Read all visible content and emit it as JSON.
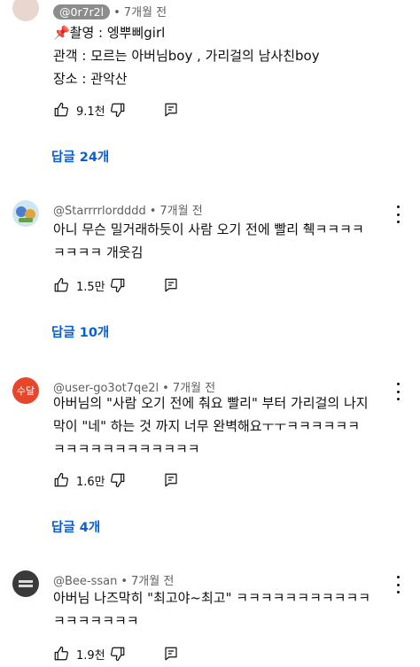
{
  "comments": [
    {
      "handle": "@0r7r2l",
      "time": "7개월 전",
      "lines": [
        "📌촬영 : 엥뿌삐girl",
        "관객 : 모르는 아버님boy , 가리걸의 남사친boy",
        "장소 : 관악산"
      ],
      "likes": "9.1천",
      "replies": "답글 24개"
    },
    {
      "handle": "@Starrrrlordddd",
      "time": "7개월 전",
      "lines": [
        "아니 무슨 밀거래하듯이 사람 오기 전에 빨리 췍ㅋㅋㅋㅋ",
        "ㅋㅋㅋㅋ 개웃김"
      ],
      "likes": "1.5만",
      "replies": "답글 10개"
    },
    {
      "handle": "@user-go3ot7qe2l",
      "time": "7개월 전",
      "avatar_text": "수달",
      "lines": [
        "아버님의 \"사람 오기 전에 춰요 빨리\" 부터 가리걸의 나지",
        "막이 \"네\" 하는 것 까지 너무 완벽해요ㅜㅜㅋㅋㅋㅋㅋㅋ",
        "ㅋㅋㅋㅋㅋㅋㅋㅋㅋㅋㅋㅋ"
      ],
      "likes": "1.6만",
      "replies": "답글 4개"
    },
    {
      "handle": "@Bee-ssan",
      "time": "7개월 전",
      "lines": [
        "아버님 나즈막히 \"최고야~최고\" ㅋㅋㅋㅋㅋㅋㅋㅋㅋㅋㅋ",
        "ㅋㅋㅋㅋㅋㅋㅋ"
      ],
      "likes": "1.9천"
    }
  ],
  "colors": {
    "link": "#065fd4",
    "meta": "#606060",
    "avatar_orange": "#e8462a"
  }
}
